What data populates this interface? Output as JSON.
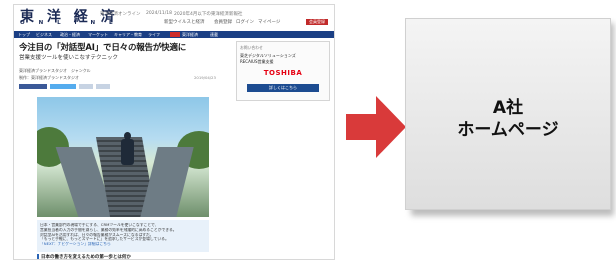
{
  "left_screenshot": {
    "logo": "東 洋 経 済",
    "logo_sub": "O N L I N E",
    "header_small": [
      "東洋経済オンライン",
      "2024/11/18",
      "2020年4月以下の東洋経済新報社"
    ],
    "header_tags": [
      "新型ウイルスと経済",
      "会員登録",
      "ログイン",
      "マイページ"
    ],
    "login_label": "会員登録",
    "nav_items": [
      "トップ",
      "ビジネス",
      "政治・経済",
      "マーケット",
      "キャリア・教育",
      "ライフ",
      "東洋経済",
      "連載"
    ],
    "article_title": "今注目の「対話型AI」で日々の報告が快適に",
    "article_subtitle": "営業支援ツールを使いこなすテクニック",
    "byline": "東洋経済ブランドスタジオ　ジャンクル",
    "byline2": "制作：東洋経済ブランドスタジオ",
    "date": "2019/04/23",
    "caption_lines": [
      "日本・営業部門の現場で手にする、CRMツールを使いこなすことで、",
      "営業担当者の入力の手間を減らし、業務の効率を飛躍的に高めることができる。",
      "対話型AIを活用すれば、日々の報告業務がスムーズになるはずだ。",
      "「もっと手軽に、もっとスマートに」を追求したサービスが登場している。"
    ],
    "caption_link": "「NEXT：ナビゲーション」詳細はこちら",
    "section_heading": "日本の働き方を変えるための第一歩とは何か",
    "sidebar": {
      "label": "お問い合わせ",
      "line1": "東芝デジタルソリューションズ",
      "line2": "RECAIUS営業支援",
      "brand": "TOSHIBA",
      "button": "詳しくはこちら",
      "note": "Sponsored"
    }
  },
  "arrow_color": "#d93a3a",
  "target_card": {
    "line1": "A社",
    "line2": "ホームページ"
  }
}
